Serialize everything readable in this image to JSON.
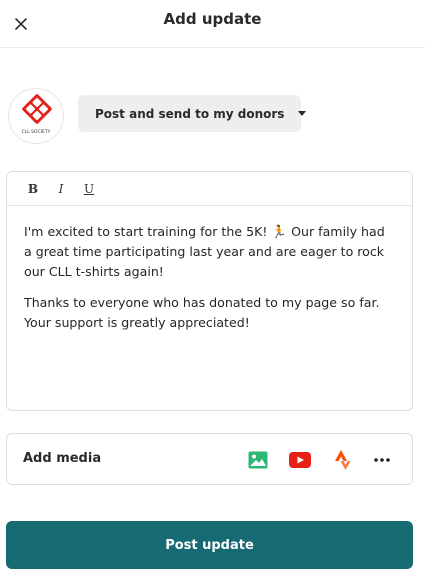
{
  "header": {
    "title": "Add update",
    "close_icon": "close-icon"
  },
  "avatar": {
    "caption": "CLL SOCIETY",
    "logo_color": "#e2231a"
  },
  "audience": {
    "selected": "Post and send to my donors",
    "icon": "caret-down-icon"
  },
  "editor": {
    "toolbar": {
      "bold": "B",
      "italic": "I",
      "underline": "U"
    },
    "paragraphs": [
      "I'm excited to start training for the 5K! 🏃 Our family had a great time participating last year and are eager to rock our CLL t-shirts again!",
      "Thanks to everyone who has donated to my page so far. Your support is greatly appreciated!"
    ]
  },
  "media": {
    "label": "Add media",
    "icons": [
      "image-icon",
      "youtube-icon",
      "strava-icon",
      "more-icon"
    ]
  },
  "footer": {
    "post_label": "Post update"
  },
  "colors": {
    "primary": "#166b72",
    "image_green": "#2bb673",
    "youtube_red": "#e62117",
    "strava_orange": "#fc4c02"
  }
}
